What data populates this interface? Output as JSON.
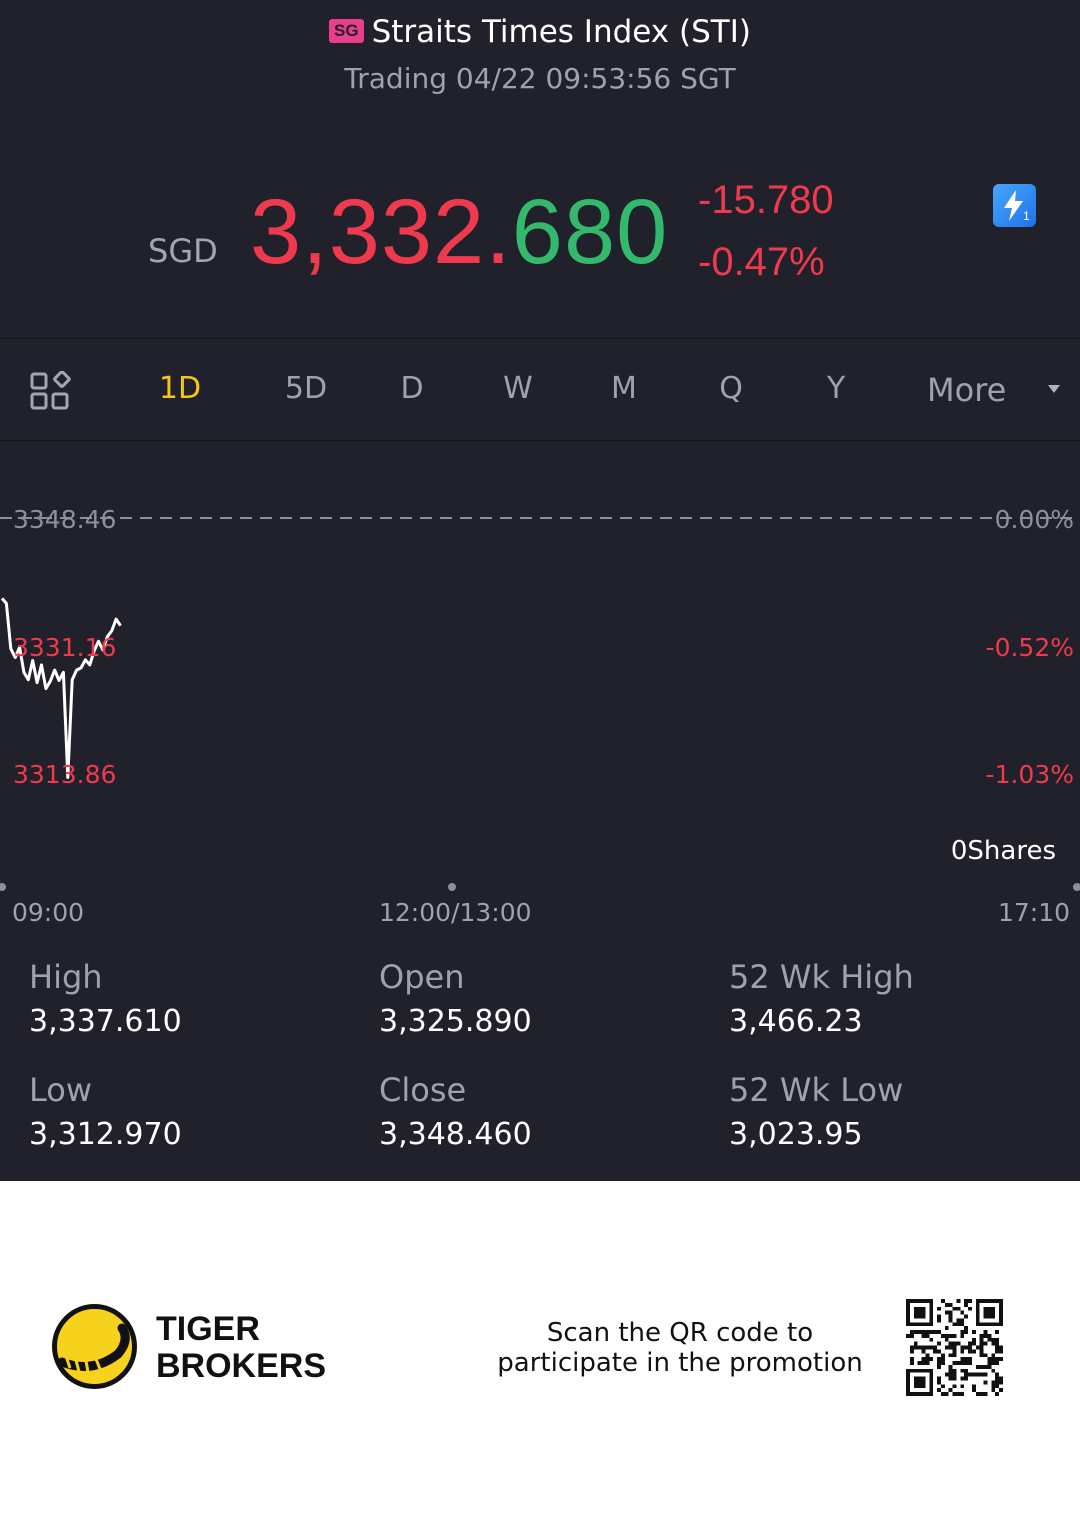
{
  "header": {
    "badge": "SG",
    "title": "Straits Times Index (STI)",
    "subtitle": "Trading 04/22 09:53:56 SGT"
  },
  "quote": {
    "currency": "SGD",
    "price_main": "3,332.",
    "price_tail": "680",
    "change": "-15.780",
    "change_pct": "-0.47%"
  },
  "tabs": {
    "items": [
      "1D",
      "5D",
      "D",
      "W",
      "M",
      "Q",
      "Y"
    ],
    "active": "1D",
    "more": "More"
  },
  "chart_data": {
    "type": "line",
    "y_left_labels": [
      "3348.46",
      "3331.16",
      "3313.86"
    ],
    "y_right_labels": [
      "0.00%",
      "-0.52%",
      "-1.03%"
    ],
    "x_labels": [
      "09:00",
      "12:00/13:00",
      "17:10"
    ],
    "ylim": [
      3313.86,
      3348.46
    ],
    "prev_close": 3348.46,
    "series": [
      {
        "x": [
          0,
          2,
          4,
          6,
          8,
          10,
          12,
          14,
          16,
          18,
          20,
          22,
          24,
          26,
          28,
          30,
          32,
          34,
          36,
          38,
          40,
          42,
          44,
          46,
          48,
          50,
          52,
          54
        ],
        "y": [
          3337.6,
          3336.9,
          3330.8,
          3329.6,
          3331.0,
          3327.6,
          3326.6,
          3329.2,
          3326.2,
          3328.6,
          3325.4,
          3326.4,
          3327.9,
          3326.5,
          3327.6,
          3313.4,
          3326.6,
          3327.9,
          3328.2,
          3329.3,
          3328.6,
          3330.5,
          3331.8,
          3330.6,
          3332.4,
          3333.2,
          3334.8,
          3333.9
        ],
        "color": "#ffffff"
      }
    ],
    "x_range": [
      0,
      490
    ],
    "shares_label": "0Shares"
  },
  "stats": {
    "high_label": "High",
    "high": "3,337.610",
    "low_label": "Low",
    "low": "3,312.970",
    "open_label": "Open",
    "open": "3,325.890",
    "close_label": "Close",
    "close": "3,348.460",
    "wk_high_label": "52 Wk High",
    "wk_high": "3,466.23",
    "wk_low_label": "52 Wk Low",
    "wk_low": "3,023.95"
  },
  "footer": {
    "brand_line1": "TIGER",
    "brand_line2": "BROKERS",
    "promo_line1": "Scan the QR code to",
    "promo_line2": "participate in the promotion"
  },
  "colors": {
    "background": "#20212b",
    "down": "#ef3a4d",
    "up": "#33b96b",
    "active_tab": "#f5c518",
    "brand_yellow": "#f7d21c"
  }
}
